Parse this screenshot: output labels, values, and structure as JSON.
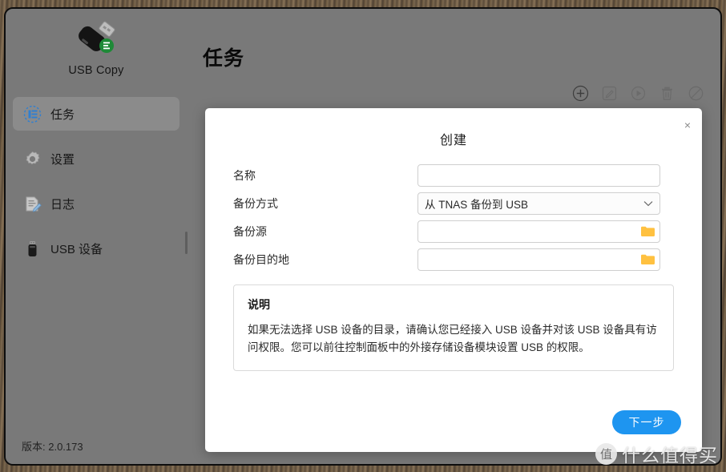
{
  "app": {
    "name": "USB Copy",
    "logo_icon": "usb-drive-icon",
    "version_text": "版本: 2.0.173"
  },
  "sidebar": {
    "items": [
      {
        "label": "任务",
        "icon": "tasks-icon",
        "active": true
      },
      {
        "label": "设置",
        "icon": "gear-icon",
        "active": false
      },
      {
        "label": "日志",
        "icon": "log-document-icon",
        "active": false
      },
      {
        "label": "USB 设备",
        "icon": "usb-device-icon",
        "active": false
      }
    ]
  },
  "main": {
    "page_title": "任务",
    "toolbar": [
      {
        "name": "add-task-button",
        "icon": "circle-plus-icon",
        "enabled": true
      },
      {
        "name": "edit-task-button",
        "icon": "pencil-square-icon",
        "enabled": false
      },
      {
        "name": "run-task-button",
        "icon": "circle-play-icon",
        "enabled": false
      },
      {
        "name": "delete-task-button",
        "icon": "trash-icon",
        "enabled": false
      },
      {
        "name": "disable-task-button",
        "icon": "circle-slash-icon",
        "enabled": false
      }
    ]
  },
  "dialog": {
    "title": "创建",
    "close_label": "×",
    "fields": [
      {
        "label": "名称",
        "type": "text",
        "value": "",
        "placeholder": ""
      },
      {
        "label": "备份方式",
        "type": "select",
        "value": "从 TNAS 备份到 USB"
      },
      {
        "label": "备份源",
        "type": "browse",
        "value": "",
        "placeholder": "",
        "button_icon": "folder-icon"
      },
      {
        "label": "备份目的地",
        "type": "browse",
        "value": "",
        "placeholder": "",
        "button_icon": "folder-icon"
      }
    ],
    "note": {
      "title": "说明",
      "body": "如果无法选择 USB 设备的目录，请确认您已经接入 USB 设备并对该 USB 设备具有访问权限。您可以前往控制面板中的外接存储设备模块设置 USB 的权限。"
    },
    "next_button": "下一步"
  },
  "watermark": {
    "badge": "值",
    "text": "什么值得买"
  },
  "colors": {
    "accent": "#1e95f0",
    "window_bg": "#797979",
    "dialog_bg": "#ffffff",
    "folder": "#ffc140",
    "logo_badge": "#1e8a37"
  }
}
